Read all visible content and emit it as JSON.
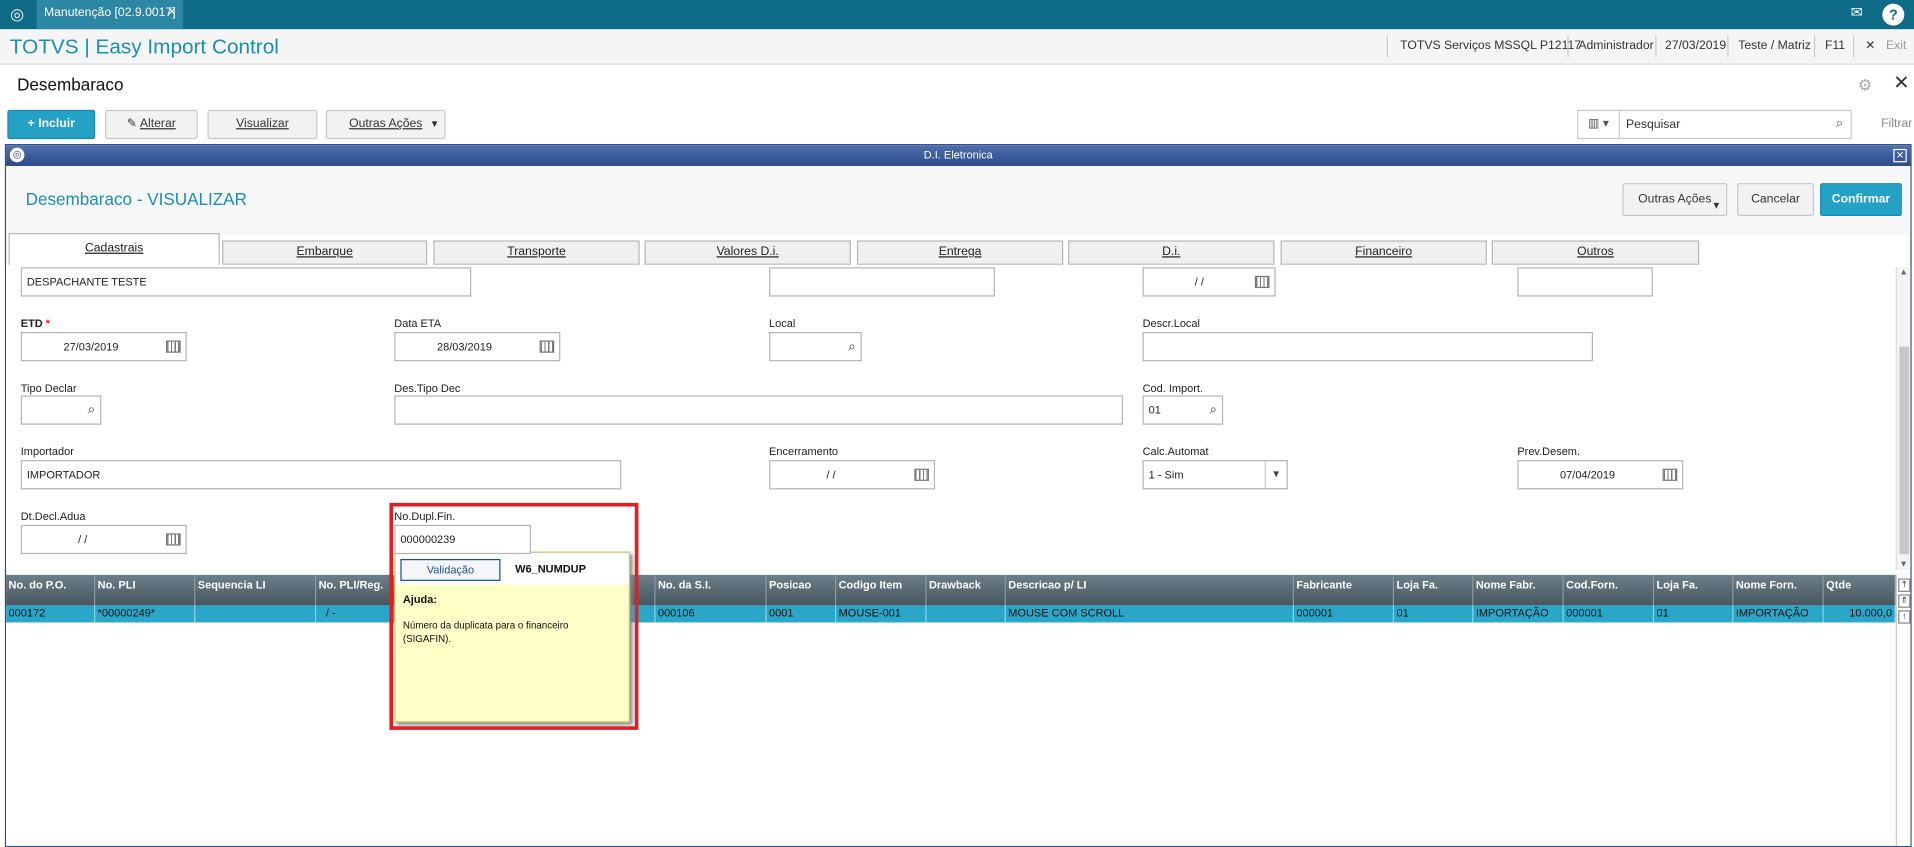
{
  "topbar": {
    "tab_label": "Manutenção [02.9.0017]",
    "tab_close": "×",
    "help": "?"
  },
  "titlebar": {
    "app_title": "TOTVS | Easy Import Control",
    "env": "TOTVS Serviços MSSQL P12117",
    "user": "Administrador",
    "date": "27/03/2019",
    "branch": "Teste / Matriz",
    "f11": "F11",
    "exit": "Exit"
  },
  "page": {
    "title": "Desembaraco"
  },
  "toolbar": {
    "incluir": "Incluir",
    "alterar": "Alterar",
    "visualizar": "Visualizar",
    "outras": "Outras Ações",
    "search_value": "Pesquisar",
    "filtrar": "Filtrar"
  },
  "dialog": {
    "bar_title": "D.I. Eletronica",
    "title": "Desembaraco - VISUALIZAR",
    "outras": "Outras Ações",
    "cancelar": "Cancelar",
    "confirmar": "Confirmar"
  },
  "tabs": [
    "Cadastrais",
    "Embarque",
    "Transporte",
    "Valores D.i.",
    "Entrega",
    "D.i.",
    "Financeiro",
    "Outros"
  ],
  "form": {
    "despachante": "DESPACHANTE TESTE",
    "blank_date": " /  /",
    "etd_label": "ETD",
    "etd_req": "*",
    "etd_value": "27/03/2019",
    "data_eta_label": "Data ETA",
    "data_eta_value": "28/03/2019",
    "local_label": "Local",
    "descr_local_label": "Descr.Local",
    "tipo_declar_label": "Tipo Declar",
    "des_tipo_dec_label": "Des.Tipo Dec",
    "cod_import_label": "Cod. Import.",
    "cod_import_value": "01",
    "importador_label": "Importador",
    "importador_value": "IMPORTADOR",
    "encerramento_label": "Encerramento",
    "encerramento_value": " /  /",
    "calc_automat_label": "Calc.Automat",
    "calc_automat_value": "1 - Sim",
    "prev_desem_label": "Prev.Desem.",
    "prev_desem_value": "07/04/2019",
    "dt_decl_adua_label": "Dt.Decl.Adua",
    "dt_decl_adua_value": " /  /",
    "no_dupl_fin_label": "No.Dupl.Fin.",
    "no_dupl_fin_value": "000000239"
  },
  "grid": {
    "headers": [
      "No. do P.O.",
      "No. PLI",
      "Sequencia LI",
      "No. PLI/Reg.",
      "No. da S.I.",
      "Posicao",
      "Codigo Item",
      "Drawback",
      "Descricao p/ LI",
      "Fabricante",
      "Loja Fa.",
      "Nome Fabr.",
      "Cod.Forn.",
      "Loja Fa.",
      "Nome Forn.",
      "Qtde"
    ],
    "row": {
      "po": "000172",
      "pli": "*00000249*",
      "seq": "",
      "pli_reg": "/      -",
      "si": "000106",
      "posicao": "0001",
      "codigo": "MOUSE-001",
      "drawback": "",
      "descricao": "MOUSE COM SCROLL",
      "fabricante": "000001",
      "loja_fa": "01",
      "nome_fabr": "IMPORTAÇÃO",
      "cod_forn": "000001",
      "loja_fa2": "01",
      "nome_forn": "IMPORTAÇÃO",
      "qtde": "10.000,0"
    }
  },
  "popup": {
    "validacao": "Validação",
    "field_code": "W6_NUMDUP",
    "ajuda_label": "Ajuda:",
    "ajuda_text": "Número da duplicata para o financeiro (SIGAFIN)."
  },
  "colors": {
    "brand": "#1a8eb5",
    "topbar": "#0e6b87",
    "primary_button": "#23a2c6",
    "highlight": "#e01e24",
    "popup_bg": "#ffffc8"
  }
}
